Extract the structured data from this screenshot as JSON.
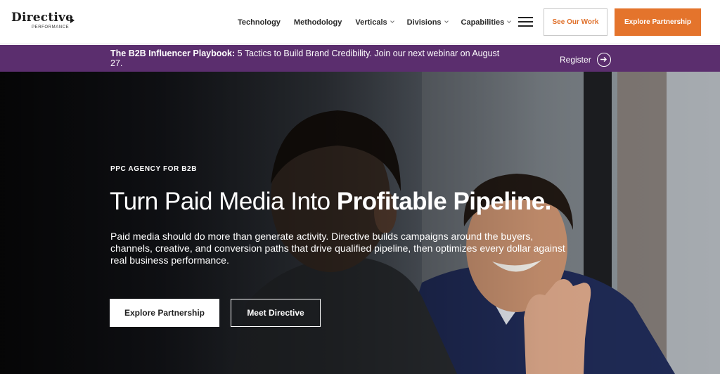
{
  "header": {
    "logo_word": "Directive",
    "logo_sub": "PERFORMANCE",
    "nav": [
      {
        "label": "Technology"
      },
      {
        "label": "Methodology"
      },
      {
        "label": "Verticals"
      },
      {
        "label": "Divisions"
      },
      {
        "label": "Capabilities"
      }
    ],
    "see_work_label": "See Our Work",
    "explore_label": "Explore Partnership"
  },
  "banner": {
    "bold_text": "The B2B Influencer Playbook:",
    "text": " 5 Tactics to Build Brand Credibility. Join our next webinar on August 27.",
    "register_label": "Register"
  },
  "hero": {
    "eyebrow": "PPC AGENCY FOR B2B",
    "title_light": "Turn Paid Media Into ",
    "title_bold": "Profitable Pipeline.",
    "description": "Paid media should do more than generate activity. Directive builds campaigns around the buyers, channels, creative, and conversion paths that drive qualified pipeline, then optimizes every dollar against real business performance.",
    "primary_button": "Explore Partnership",
    "secondary_button": "Meet Directive"
  },
  "colors": {
    "accent_orange": "#e4742c",
    "banner_purple": "#5b2e6e"
  }
}
